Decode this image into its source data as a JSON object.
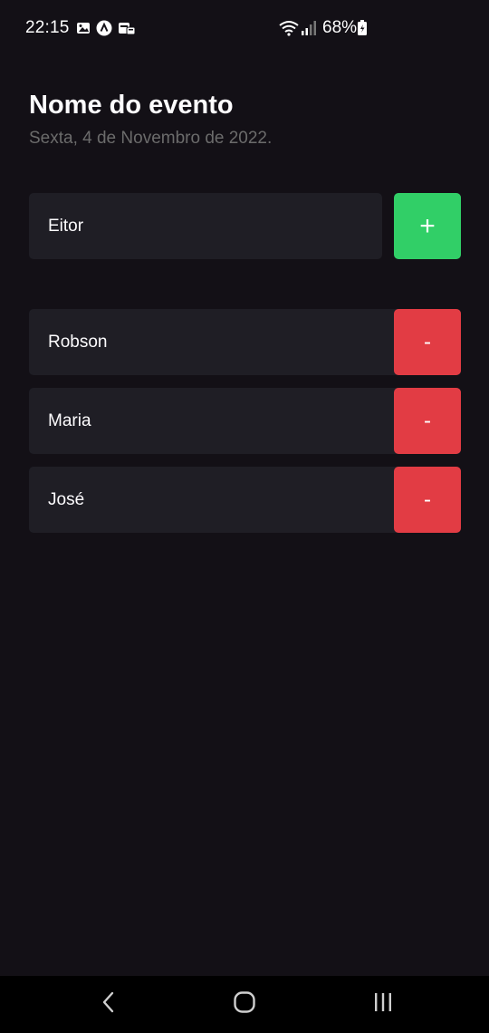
{
  "status_bar": {
    "time": "22:15",
    "battery": "68%",
    "left_icons": [
      "gallery-icon",
      "app-icon",
      "notification-icon"
    ],
    "right_icons": [
      "wifi-icon",
      "signal-icon",
      "battery-icon"
    ]
  },
  "header": {
    "title": "Nome do evento",
    "date": "Sexta, 4 de Novembro de 2022."
  },
  "form": {
    "input_value": "Eitor",
    "add_label": "+"
  },
  "participants": [
    {
      "name": "Robson",
      "remove_label": "-"
    },
    {
      "name": "Maria",
      "remove_label": "-"
    },
    {
      "name": "José",
      "remove_label": "-"
    }
  ],
  "colors": {
    "background": "#131016",
    "card": "#1F1E25",
    "add": "#31CF67",
    "remove": "#E23C44",
    "muted_text": "#6B6B6B"
  },
  "nav_bar": {
    "icons": [
      "back-icon",
      "home-icon",
      "recents-icon"
    ]
  }
}
